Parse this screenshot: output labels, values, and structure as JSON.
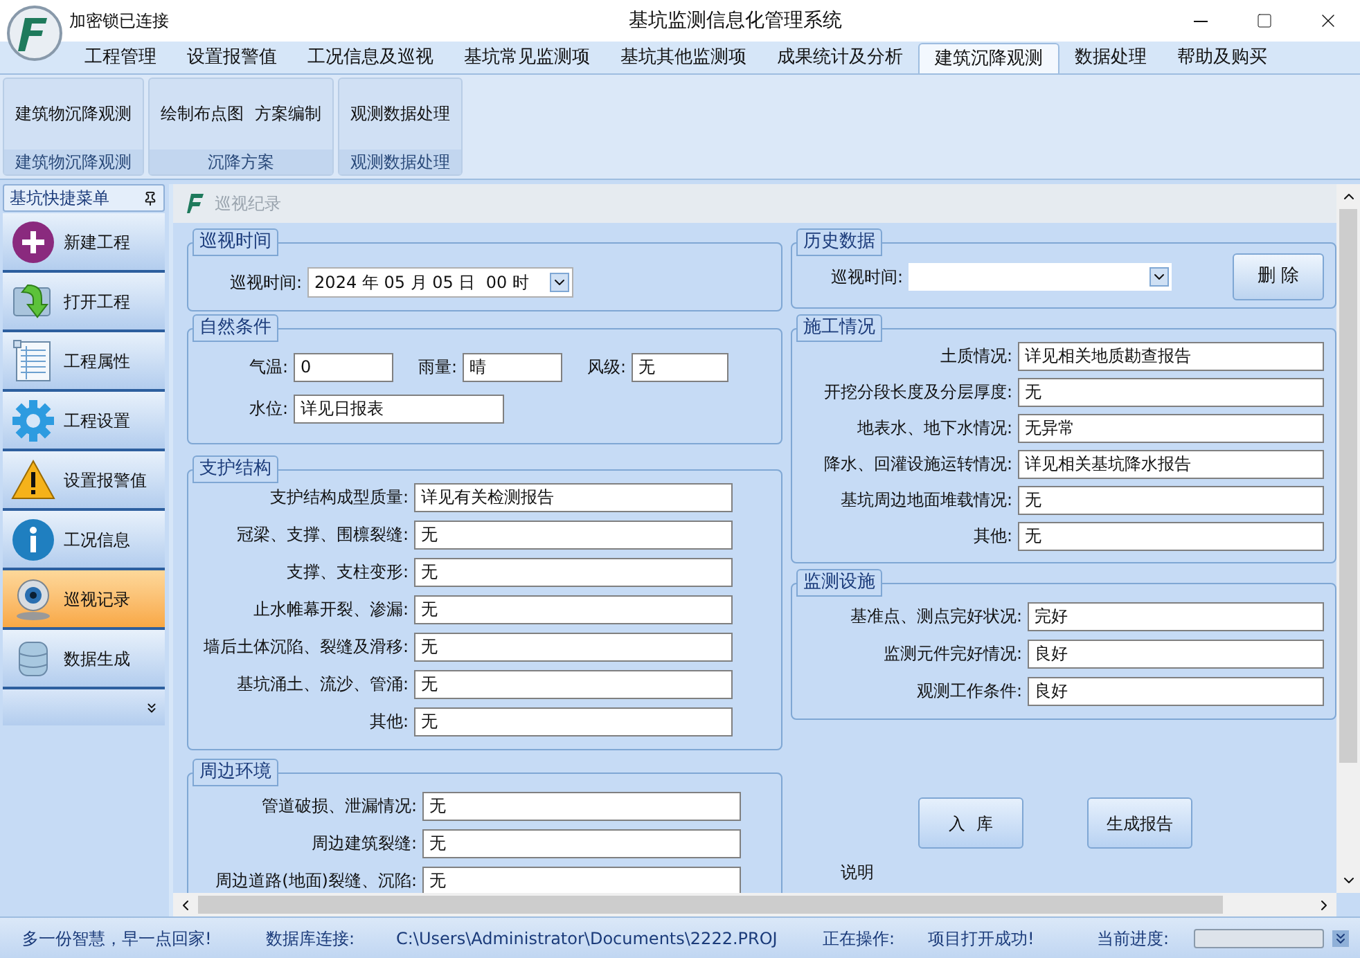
{
  "title_bar": {
    "lock_status": "加密锁已连接",
    "title": "基坑监测信息化管理系统"
  },
  "menu_tabs": [
    {
      "label": "工程管理",
      "selected": false
    },
    {
      "label": "设置报警值",
      "selected": false
    },
    {
      "label": "工况信息及巡视",
      "selected": false
    },
    {
      "label": "基坑常见监测项",
      "selected": false
    },
    {
      "label": "基坑其他监测项",
      "selected": false
    },
    {
      "label": "成果统计及分析",
      "selected": false
    },
    {
      "label": "建筑沉降观测",
      "selected": true
    },
    {
      "label": "数据处理",
      "selected": false
    },
    {
      "label": "帮助及购买",
      "selected": false
    }
  ],
  "ribbon_groups": [
    {
      "buttons": [
        "建筑物沉降观测"
      ],
      "caption": "建筑物沉降观测"
    },
    {
      "buttons": [
        "绘制布点图",
        "方案编制"
      ],
      "caption": "沉降方案"
    },
    {
      "buttons": [
        "观测数据处理"
      ],
      "caption": "观测数据处理"
    }
  ],
  "sidebar": {
    "title": "基坑快捷菜单",
    "items": [
      {
        "label": "新建工程",
        "kind": "plus",
        "selected": false
      },
      {
        "label": "打开工程",
        "kind": "open",
        "selected": false
      },
      {
        "label": "工程属性",
        "kind": "sheet",
        "selected": false
      },
      {
        "label": "工程设置",
        "kind": "gear",
        "selected": false
      },
      {
        "label": "设置报警值",
        "kind": "warning",
        "selected": false
      },
      {
        "label": "工况信息",
        "kind": "info",
        "selected": false
      },
      {
        "label": "巡视记录",
        "kind": "camera",
        "selected": true
      },
      {
        "label": "数据生成",
        "kind": "database",
        "selected": false
      }
    ]
  },
  "document": {
    "title": "巡视纪录"
  },
  "patrol_time": {
    "title": "巡视时间",
    "label": "巡视时间:",
    "value": "2024 年 05 月 05 日  00 时"
  },
  "natural": {
    "title": "自然条件",
    "fields": [
      {
        "label": "气温:",
        "value": "0"
      },
      {
        "label": "雨量:",
        "value": "晴"
      },
      {
        "label": "风级:",
        "value": "无"
      },
      {
        "label": "水位:",
        "value": "详见日报表"
      }
    ]
  },
  "support": {
    "title": "支护结构",
    "fields": [
      {
        "label": "支护结构成型质量:",
        "value": "详见有关检测报告"
      },
      {
        "label": "冠梁、支撑、围檩裂缝:",
        "value": "无"
      },
      {
        "label": "支撑、支柱变形:",
        "value": "无"
      },
      {
        "label": "止水帷幕开裂、渗漏:",
        "value": "无"
      },
      {
        "label": "墙后土体沉陷、裂缝及滑移:",
        "value": "无"
      },
      {
        "label": "基坑涌土、流沙、管涌:",
        "value": "无"
      },
      {
        "label": "其他:",
        "value": "无"
      }
    ]
  },
  "surroundings": {
    "title": "周边环境",
    "fields": [
      {
        "label": "管道破损、泄漏情况:",
        "value": "无"
      },
      {
        "label": "周边建筑裂缝:",
        "value": "无"
      },
      {
        "label": "周边道路(地面)裂缝、沉陷:",
        "value": "无"
      }
    ]
  },
  "history": {
    "title": "历史数据",
    "label": "巡视时间:",
    "delete_button": "删 除"
  },
  "construction": {
    "title": "施工情况",
    "fields": [
      {
        "label": "土质情况:",
        "value": "详见相关地质勘查报告"
      },
      {
        "label": "开挖分段长度及分层厚度:",
        "value": "无"
      },
      {
        "label": "地表水、地下水情况:",
        "value": "无异常"
      },
      {
        "label": "降水、回灌设施运转情况:",
        "value": "详见相关基坑降水报告"
      },
      {
        "label": "基坑周边地面堆载情况:",
        "value": "无"
      },
      {
        "label": "其他:",
        "value": "无"
      }
    ]
  },
  "facilities": {
    "title": "监测设施",
    "fields": [
      {
        "label": "基准点、测点完好状况:",
        "value": "完好"
      },
      {
        "label": "监测元件完好情况:",
        "value": "良好"
      },
      {
        "label": "观测工作条件:",
        "value": "良好"
      }
    ]
  },
  "actions": [
    "入  库",
    "生成报告"
  ],
  "note_label": "说明",
  "status_bar": {
    "slogan": "多一份智慧，早一点回家!",
    "db_label": "数据库连接:",
    "db_path": "C:\\Users\\Administrator\\Documents\\2222.PROJ",
    "op_label": "正在操作:",
    "op_value": "项目打开成功!",
    "progress_label": "当前进度:",
    "progress": {
      "level": 0
    }
  }
}
